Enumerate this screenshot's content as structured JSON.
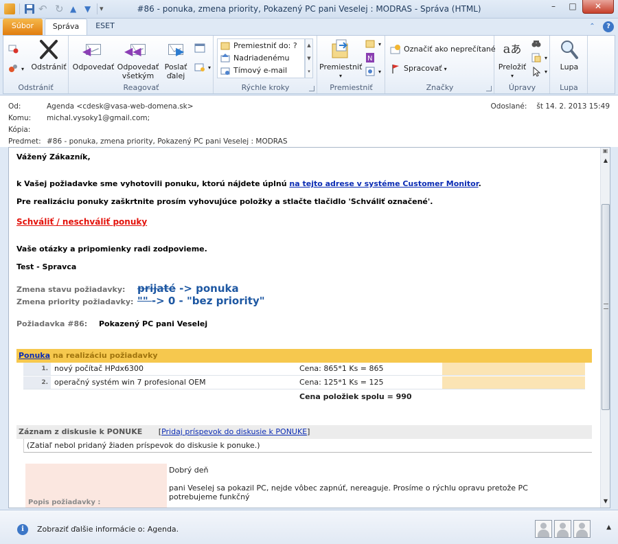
{
  "window": {
    "title": "#86 - ponuka, zmena priority, Pokazený PC pani Veselej : MODRAS - Správa (HTML)",
    "min": "–",
    "max": "□",
    "close": "✕"
  },
  "tabs": {
    "file": "Súbor",
    "message": "Správa",
    "eset": "ESET"
  },
  "ribbon": {
    "delete_group": {
      "label": "Odstrániť",
      "delete": "Odstrániť"
    },
    "respond_group": {
      "label": "Reagovať",
      "reply": "Odpovedať",
      "reply_all_1": "Odpovedať",
      "reply_all_2": "všetkým",
      "forward_1": "Poslať",
      "forward_2": "ďalej"
    },
    "quick_steps": {
      "label": "Rýchle kroky",
      "items": [
        "Premiestniť do: ?",
        "Nadriadenému",
        "Tímový e-mail"
      ]
    },
    "move_group": {
      "label": "Premiestniť",
      "move": "Premiestniť"
    },
    "tags_group": {
      "label": "Značky",
      "mark_unread": "Označiť ako neprečítané",
      "followup": "Spracovať"
    },
    "editing_group": {
      "label": "Úpravy",
      "translate": "Preložiť"
    },
    "zoom_group": {
      "label": "Lupa",
      "zoom": "Lupa"
    }
  },
  "header": {
    "from_label": "Od:",
    "from": "Agenda <cdesk@vasa-web-domena.sk>",
    "to_label": "Komu:",
    "to": "michal.vysoky1@gmail.com;",
    "cc_label": "Kópia:",
    "cc": "",
    "subject_label": "Predmet:",
    "subject": "#86 - ponuka, zmena priority, Pokazený PC pani Veselej : MODRAS",
    "sent_label": "Odoslané:",
    "sent": "št 14. 2. 2013 15:49"
  },
  "body": {
    "greeting": "Vážený Zákazník,",
    "intro_text": "k Vašej požiadavke sme vyhotovili ponuku, ktorú nájdete úplnú ",
    "intro_link": "na tejto adrese v systéme Customer Monitor",
    "intro_end": ".",
    "instructions": "Pre realizáciu ponuky zaškrtnite prosím vyhovujúce položky a stlačte tlačidlo 'Schváliť označené'.",
    "approve_link": "Schváliť / neschváliť ponuky",
    "questions": "Vaše otázky a pripomienky radi zodpovieme.",
    "signature": "Test - Spravca",
    "status_change_label": "Zmena stavu požiadavky:",
    "status_old": "prijaté",
    "status_new": " -> ponuka",
    "priority_change_label": "Zmena priority požiadavky:",
    "priority_old": " \"\" ",
    "priority_new": " -> 0 - \"bez priority\"",
    "request_label": "Požiadavka #86:",
    "request_title": "Pokazený PC pani Veselej",
    "offer_link": "Ponuka",
    "offer_title": " na realizáciu požiadavky",
    "items": [
      {
        "num": "1.",
        "name": "nový počítač HPdx6300",
        "price": "Cena: 865*1 Ks = 865"
      },
      {
        "num": "2.",
        "name": "operačný systém win 7 profesional OEM",
        "price": "Cena: 125*1 Ks = 125"
      }
    ],
    "total": "Cena položiek spolu = 990",
    "discussion_title": "Záznam z diskusie k PONUKE",
    "discussion_link_pre": "[",
    "discussion_link": "Pridaj príspevok do diskusie k PONUKE",
    "discussion_link_post": "]",
    "discussion_empty": "(Zatiaľ nebol pridaný žiaden príspevok do diskusie k ponuke.)",
    "desc_label": "Popis požiadavky :",
    "desc_line1": "Dobrý deň",
    "desc_line2": "pani Veselej sa pokazil PC, nejde vôbec zapnúť, nereaguje. Prosíme o rýchlu opravu pretože PC",
    "desc_line3": "potrebujeme funkčný"
  },
  "infobar": {
    "text": "Zobraziť ďalšie informácie o: Agenda."
  },
  "colors": {
    "link": "#0a2bb3",
    "approve_link": "#e3120b",
    "offer_bar": "#f6c84e",
    "change_text": "#1d57a2"
  }
}
